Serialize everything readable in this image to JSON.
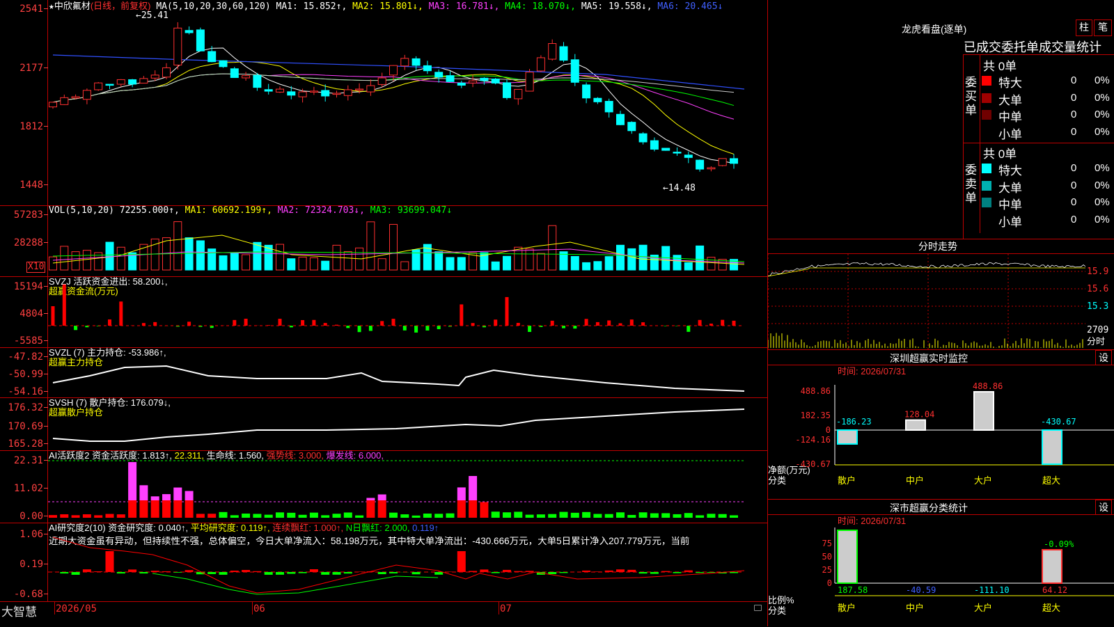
{
  "stock": {
    "star": "★",
    "name": "中欣氟材",
    "period": "(日线，前复权)",
    "ma_line": [
      {
        "label": "MA(5,10,20,30,60,120)",
        "color": "#ffffff"
      },
      {
        "label": "MA1: 15.852↑,",
        "color": "#ffffff"
      },
      {
        "label": "MA2: 15.801↓,",
        "color": "#ffff00"
      },
      {
        "label": "MA3: 16.781↓,",
        "color": "#ff40ff"
      },
      {
        "label": "MA4: 18.070↓,",
        "color": "#00ff00"
      },
      {
        "label": "MA5: 19.558↓,",
        "color": "#ffffff"
      },
      {
        "label": "MA6: 20.465↓",
        "color": "#4060ff"
      }
    ],
    "high_label": "←25.41",
    "low_label": "←14.48"
  },
  "main_y": [
    "2541",
    "2177",
    "1812",
    "1448"
  ],
  "vol": {
    "y": [
      "57283",
      "28288"
    ],
    "unit": "X10",
    "header": [
      {
        "label": "VOL(5,10,20)",
        "color": "#ffffff"
      },
      {
        "label": "72255.000↑,",
        "color": "#ffffff"
      },
      {
        "label": "MA1: 60692.199↑,",
        "color": "#ffff00"
      },
      {
        "label": "MA2: 72324.703↓,",
        "color": "#ff40ff"
      },
      {
        "label": "MA3: 93699.047↓",
        "color": "#00ff00"
      }
    ]
  },
  "svzj": {
    "y": [
      "15194",
      "4804",
      "-5585"
    ],
    "header": "SVZJ  活跃资金进出: 58.200↓,",
    "sub": "超赢资金流(万元)"
  },
  "svzl": {
    "y": [
      "-47.82",
      "-50.99",
      "-54.16"
    ],
    "header": "SVZL (7) 主力持仓: -53.986↑,",
    "sub": "超赢主力持仓"
  },
  "svsh": {
    "y": [
      "176.32",
      "170.69",
      "165.28"
    ],
    "header": "SVSH (7) 散户持仓: 176.079↓,",
    "sub": "超赢散户持仓"
  },
  "ai1": {
    "y": [
      "22.31",
      "11.02",
      "0.00"
    ],
    "header": [
      {
        "label": "AI活跃度2 资金活跃度: 1.813↑,",
        "color": "#ffffff"
      },
      {
        "label": "22.311,",
        "color": "#ffff00"
      },
      {
        "label": "生命线: 1.560,",
        "color": "#ffffff"
      },
      {
        "label": "强势线: 3.000,",
        "color": "#ff3030"
      },
      {
        "label": "爆发线: 6.000,",
        "color": "#ff40ff"
      }
    ]
  },
  "ai2": {
    "y": [
      "1.06",
      "0.19",
      "-0.68"
    ],
    "header": [
      {
        "label": "AI研究度2(10) 资金研究度: 0.040↑,",
        "color": "#ffffff"
      },
      {
        "label": "平均研究度: 0.119↑,",
        "color": "#ffff00"
      },
      {
        "label": "连续飘红: 1.000↑,",
        "color": "#ff3030"
      },
      {
        "label": "N日飘红: 2.000,",
        "color": "#00ff00"
      },
      {
        "label": "0.119↑",
        "color": "#4060ff"
      }
    ],
    "text": "近期大资金虽有异动，但持续性不强，总体偏空，今日大单净流入：58.198万元，其中特大单净流出：-430.666万元，大单5日累计净入207.779万元，当前"
  },
  "bottom": {
    "brand": "大智慧",
    "dates": [
      "2026/05",
      "06",
      "07"
    ]
  },
  "dragon": {
    "title": "龙虎看盘(逐单)",
    "btn1": "柱",
    "btn2": "笔",
    "subtitle": "已成交委托单成交量统计",
    "buy": {
      "side": "委买单",
      "total": "共 0单",
      "rows": [
        {
          "label": "特大",
          "color": "#ff0000",
          "n": "0",
          "pct": "0%"
        },
        {
          "label": "大单",
          "color": "#a00000",
          "n": "0",
          "pct": "0%"
        },
        {
          "label": "中单",
          "color": "#700000",
          "n": "0",
          "pct": "0%"
        },
        {
          "label": "小单",
          "color": "",
          "n": "0",
          "pct": "0%"
        }
      ]
    },
    "sell": {
      "side": "委卖单",
      "total": "共 0单",
      "rows": [
        {
          "label": "特大",
          "color": "#00ffff",
          "n": "0",
          "pct": "0%"
        },
        {
          "label": "大单",
          "color": "#00b0b0",
          "n": "0",
          "pct": "0%"
        },
        {
          "label": "中单",
          "color": "#008080",
          "n": "0",
          "pct": "0%"
        },
        {
          "label": "小单",
          "color": "",
          "n": "0",
          "pct": "0%"
        }
      ]
    }
  },
  "intraday": {
    "title": "分时走势",
    "y": [
      "15.9",
      "15.6",
      "15.3"
    ],
    "vol_label": "2709",
    "unit": "分时"
  },
  "sz_monitor": {
    "title": "深圳超赢实时监控",
    "btn": "设",
    "time": "时间: 2026/07/31",
    "y": [
      "488.86",
      "182.35",
      "0",
      "-124.16",
      "-430.67"
    ],
    "left_label1": "净额(万元)",
    "left_label2": "分类",
    "categories": [
      "散户",
      "中户",
      "大户",
      "超大"
    ],
    "chart_data": {
      "type": "bar",
      "categories": [
        "散户",
        "中户",
        "大户",
        "超大"
      ],
      "values": [
        -186.23,
        128.04,
        488.86,
        -430.67
      ],
      "ylabel": "净额(万元)",
      "ylim": [
        -430.67,
        488.86
      ]
    }
  },
  "sz_stats": {
    "title": "深市超赢分类统计",
    "btn": "设",
    "time": "时间: 2026/07/31",
    "y": [
      "75",
      "50",
      "25",
      "0"
    ],
    "left_label1": "比例%",
    "left_label2": "分类",
    "categories": [
      "散户",
      "中户",
      "大户",
      "超大"
    ],
    "bottom_values": [
      "187.58",
      "-40.59",
      "-111.10",
      "64.12"
    ],
    "top_label": "-0.09%",
    "chart_data": {
      "type": "bar",
      "categories": [
        "散户",
        "中户",
        "大户",
        "超大"
      ],
      "values": [
        187.58,
        -40.59,
        -111.1,
        64.12
      ],
      "ylabel": "比例%",
      "ylim": [
        0,
        75
      ]
    }
  }
}
